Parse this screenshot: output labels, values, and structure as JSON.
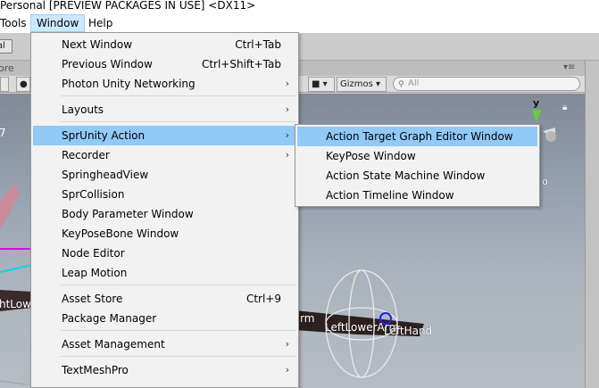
{
  "titlebar": {
    "text": "Personal [PREVIEW PACKAGES IN USE] <DX11>"
  },
  "menubar": {
    "items": [
      "Tools",
      "Window",
      "Help"
    ]
  },
  "background": {
    "left_button_fragment": "al",
    "left_tab_fragment": "ore",
    "scene_toolbar": {
      "gizmos_label": "Gizmos",
      "search_placeholder": "All",
      "dropdown_arrow": "▾"
    },
    "scene_labels": {
      "left_low": "htLow",
      "number_fragment": "7",
      "arm": "rm",
      "left_lower_arm": "LeftLowerArm",
      "left_hand": "LeftHand",
      "axis_y": "y",
      "small_o": "o"
    }
  },
  "window_menu": {
    "items": [
      {
        "label": "Next Window",
        "shortcut": "Ctrl+Tab",
        "submenu": false
      },
      {
        "label": "Previous Window",
        "shortcut": "Ctrl+Shift+Tab",
        "submenu": false
      },
      {
        "label": "Photon Unity Networking",
        "shortcut": "",
        "submenu": true
      },
      {
        "label": "Layouts",
        "shortcut": "",
        "submenu": true
      },
      {
        "label": "SprUnity Action",
        "shortcut": "",
        "submenu": true,
        "highlighted": true
      },
      {
        "label": "Recorder",
        "shortcut": "",
        "submenu": true
      },
      {
        "label": "SpringheadView",
        "shortcut": "",
        "submenu": false
      },
      {
        "label": "SprCollision",
        "shortcut": "",
        "submenu": false
      },
      {
        "label": "Body Parameter Window",
        "shortcut": "",
        "submenu": false
      },
      {
        "label": "KeyPoseBone Window",
        "shortcut": "",
        "submenu": false
      },
      {
        "label": "Node Editor",
        "shortcut": "",
        "submenu": false
      },
      {
        "label": "Leap Motion",
        "shortcut": "",
        "submenu": false
      },
      {
        "label": "Asset Store",
        "shortcut": "Ctrl+9",
        "submenu": false
      },
      {
        "label": "Package Manager",
        "shortcut": "",
        "submenu": false
      },
      {
        "label": "Asset Management",
        "shortcut": "",
        "submenu": true
      },
      {
        "label": "TextMeshPro",
        "shortcut": "",
        "submenu": true
      }
    ]
  },
  "sprunity_submenu": {
    "items": [
      {
        "label": "Action Target Graph Editor Window",
        "highlighted": true
      },
      {
        "label": "KeyPose Window"
      },
      {
        "label": "Action State Machine Window"
      },
      {
        "label": "Action Timeline Window"
      }
    ]
  },
  "glyphs": {
    "submenu_arrow": "›"
  }
}
